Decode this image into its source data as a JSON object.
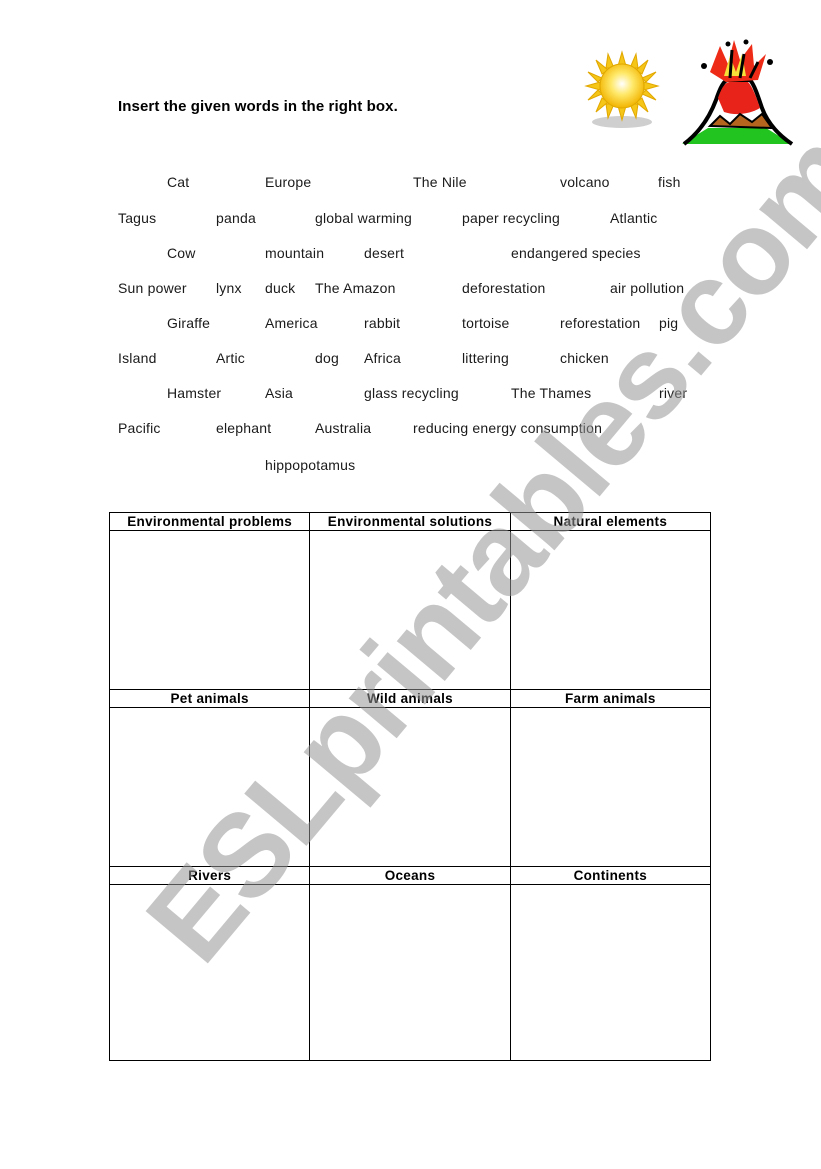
{
  "instruction": "Insert the given words in the right box.",
  "images": {
    "sun": "sun-clipart",
    "volcano": "volcano-clipart"
  },
  "word_bank": [
    [
      "Cat",
      "Europe",
      "The Nile",
      "volcano",
      "fish"
    ],
    [
      "Tagus",
      "panda",
      "global warming",
      "paper recycling",
      "Atlantic"
    ],
    [
      "Cow",
      "mountain",
      "desert",
      "endangered species"
    ],
    [
      "Sun power",
      "lynx",
      "duck",
      "The Amazon",
      "deforestation",
      "air pollution"
    ],
    [
      "Giraffe",
      "America",
      "rabbit",
      "tortoise",
      "reforestation",
      "pig"
    ],
    [
      "Island",
      "Artic",
      "dog",
      "Africa",
      "littering",
      "chicken"
    ],
    [
      "Hamster",
      "Asia",
      "glass recycling",
      "The Thames",
      "river"
    ],
    [
      "Pacific",
      "elephant",
      "Australia",
      "reducing energy consumption"
    ],
    [
      "hippopotamus"
    ]
  ],
  "table": {
    "rows": [
      [
        "Environmental problems",
        "Environmental solutions",
        "Natural elements"
      ],
      [
        "Pet animals",
        "Wild animals",
        "Farm animals"
      ],
      [
        "Rivers",
        "Oceans",
        "Continents"
      ]
    ]
  },
  "watermark": "ESLprintables.com"
}
